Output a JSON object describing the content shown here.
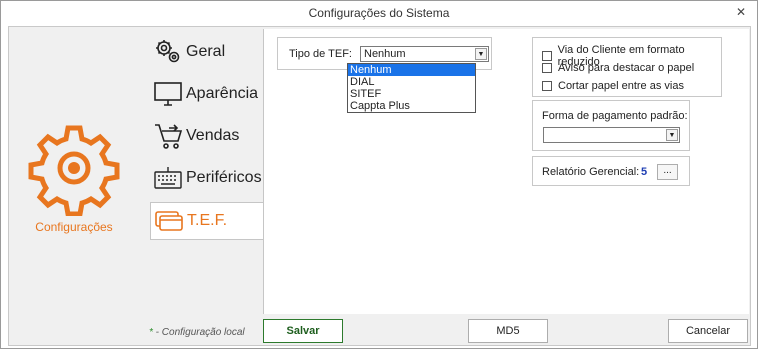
{
  "window": {
    "title": "Configurações do Sistema",
    "close_glyph": "✕"
  },
  "hero": {
    "label": "Configurações",
    "icon": "gear-icon",
    "accent": "#e8761f"
  },
  "menu": {
    "items": [
      {
        "label": "Geral",
        "icon": "gears-icon"
      },
      {
        "label": "Aparência",
        "icon": "monitor-icon"
      },
      {
        "label": "Vendas",
        "icon": "cart-icon"
      },
      {
        "label": "Periféricos",
        "icon": "keyboard-icon"
      },
      {
        "label": "T.E.F.",
        "icon": "card-icon"
      }
    ],
    "active": "T.E.F."
  },
  "tef": {
    "label": "Tipo de TEF:",
    "selected": "Nenhum",
    "options": [
      "Nenhum",
      "DIAL",
      "SITEF",
      "Cappta Plus"
    ]
  },
  "options": {
    "items": [
      {
        "label": "Via do Cliente em formato reduzido",
        "checked": false
      },
      {
        "label": "Aviso para destacar o papel",
        "checked": false
      },
      {
        "label": "Cortar papel entre as vias",
        "checked": false
      }
    ]
  },
  "payment": {
    "label": "Forma de pagamento padrão:",
    "selected": ""
  },
  "report": {
    "label": "Relatório Gerencial:",
    "value": "5",
    "button": "..."
  },
  "footer": {
    "note_star": "*",
    "note_text": " - Configuração local",
    "save": "Salvar",
    "md5": "MD5",
    "cancel": "Cancelar"
  }
}
